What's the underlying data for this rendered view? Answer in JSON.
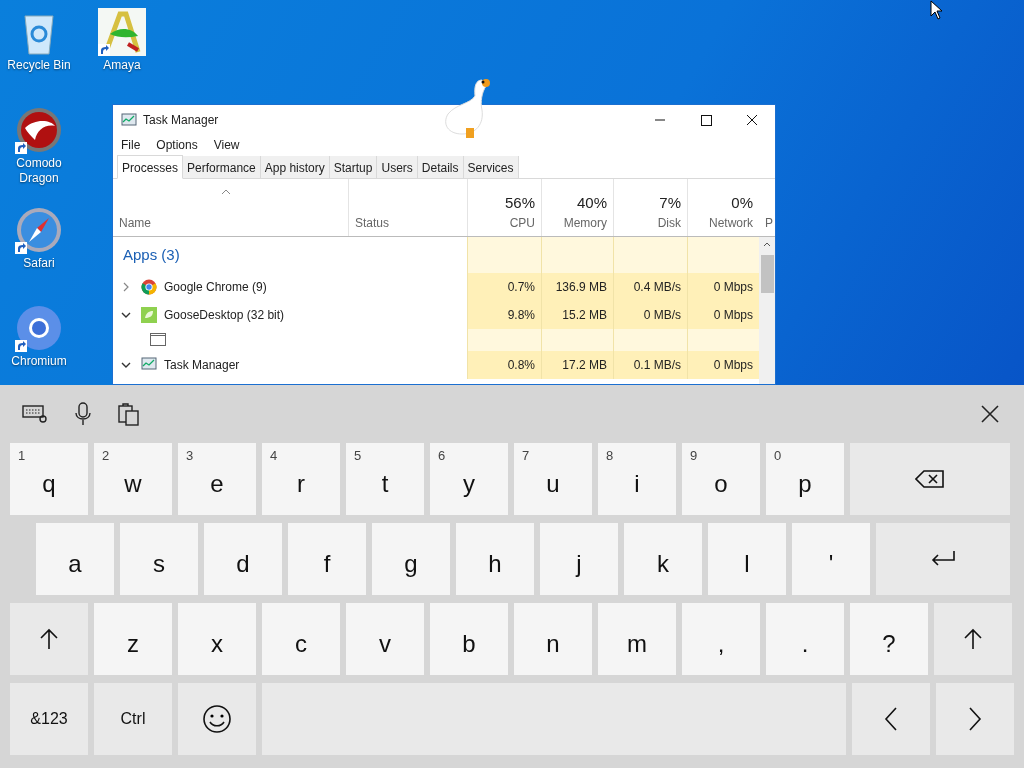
{
  "desktop_icons": [
    {
      "label": "Recycle Bin",
      "kind": "recycle",
      "shortcut": false
    },
    {
      "label": "Amaya",
      "kind": "amaya",
      "shortcut": true
    },
    {
      "label": "Comodo Dragon",
      "kind": "dragon",
      "shortcut": true
    },
    {
      "label": "Safari",
      "kind": "safari",
      "shortcut": true
    },
    {
      "label": "Chromium",
      "kind": "chromium",
      "shortcut": true
    }
  ],
  "window": {
    "title": "Task Manager",
    "menu": [
      "File",
      "Options",
      "View"
    ],
    "tabs": [
      {
        "label": "Processes",
        "selected": true
      },
      {
        "label": "Performance",
        "selected": false
      },
      {
        "label": "App history",
        "selected": false
      },
      {
        "label": "Startup",
        "selected": false
      },
      {
        "label": "Users",
        "selected": false
      },
      {
        "label": "Details",
        "selected": false
      },
      {
        "label": "Services",
        "selected": false
      }
    ],
    "columns": [
      {
        "label": "Name"
      },
      {
        "label": "Status"
      },
      {
        "label": "CPU",
        "percent": "56%"
      },
      {
        "label": "Memory",
        "percent": "40%"
      },
      {
        "label": "Disk",
        "percent": "7%"
      },
      {
        "label": "Network",
        "percent": "0%"
      },
      {
        "label": "P"
      }
    ],
    "group": "Apps (3)",
    "rows": [
      {
        "kind": "app",
        "name": "Google Chrome (9)",
        "expanded": false,
        "values": [
          "0.7%",
          "136.9 MB",
          "0.4 MB/s",
          "0 Mbps"
        ]
      },
      {
        "kind": "app",
        "name": "GooseDesktop (32 bit)",
        "expanded": true,
        "values": [
          "9.8%",
          "15.2 MB",
          "0 MB/s",
          "0 Mbps"
        ]
      },
      {
        "kind": "child"
      },
      {
        "kind": "app",
        "name": "Task Manager",
        "expanded": true,
        "values": [
          "0.8%",
          "17.2 MB",
          "0.1 MB/s",
          "0 Mbps"
        ]
      }
    ]
  },
  "keyboard": {
    "rows": [
      [
        {
          "kind": "letter",
          "label": "q",
          "hint": "1"
        },
        {
          "kind": "letter",
          "label": "w",
          "hint": "2"
        },
        {
          "kind": "letter",
          "label": "e",
          "hint": "3"
        },
        {
          "kind": "letter",
          "label": "r",
          "hint": "4"
        },
        {
          "kind": "letter",
          "label": "t",
          "hint": "5"
        },
        {
          "kind": "letter",
          "label": "y",
          "hint": "6"
        },
        {
          "kind": "letter",
          "label": "u",
          "hint": "7"
        },
        {
          "kind": "letter",
          "label": "i",
          "hint": "8"
        },
        {
          "kind": "letter",
          "label": "o",
          "hint": "9"
        },
        {
          "kind": "letter",
          "label": "p",
          "hint": "0"
        },
        {
          "kind": "backspace"
        }
      ],
      [
        {
          "kind": "letter",
          "label": "a"
        },
        {
          "kind": "letter",
          "label": "s"
        },
        {
          "kind": "letter",
          "label": "d"
        },
        {
          "kind": "letter",
          "label": "f"
        },
        {
          "kind": "letter",
          "label": "g"
        },
        {
          "kind": "letter",
          "label": "h"
        },
        {
          "kind": "letter",
          "label": "j"
        },
        {
          "kind": "letter",
          "label": "k"
        },
        {
          "kind": "letter",
          "label": "l"
        },
        {
          "kind": "letter",
          "label": "'"
        },
        {
          "kind": "enter"
        }
      ],
      [
        {
          "kind": "shift"
        },
        {
          "kind": "letter",
          "label": "z"
        },
        {
          "kind": "letter",
          "label": "x"
        },
        {
          "kind": "letter",
          "label": "c"
        },
        {
          "kind": "letter",
          "label": "v"
        },
        {
          "kind": "letter",
          "label": "b"
        },
        {
          "kind": "letter",
          "label": "n"
        },
        {
          "kind": "letter",
          "label": "m"
        },
        {
          "kind": "letter",
          "label": ","
        },
        {
          "kind": "letter",
          "label": "."
        },
        {
          "kind": "letter",
          "label": "?"
        },
        {
          "kind": "shift"
        }
      ],
      [
        {
          "kind": "func",
          "label": "&123"
        },
        {
          "kind": "func",
          "label": "Ctrl"
        },
        {
          "kind": "emoji"
        },
        {
          "kind": "space"
        },
        {
          "kind": "left"
        },
        {
          "kind": "right"
        }
      ]
    ]
  }
}
